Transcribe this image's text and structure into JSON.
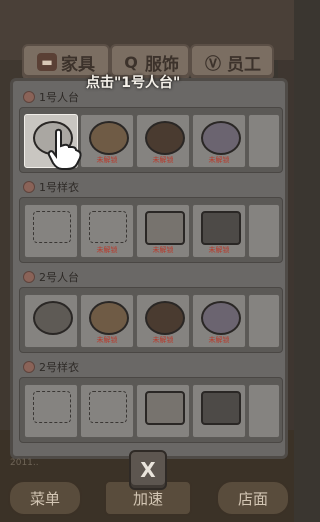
{
  "tabs": [
    {
      "label": "家具",
      "icon": "sofa-icon"
    },
    {
      "label": "服饰",
      "icon": "clothes-icon"
    },
    {
      "label": "员工",
      "icon": "staff-icon"
    }
  ],
  "hint": "点击\"1号人台\"",
  "sections": [
    {
      "title": "1号人台",
      "kind": "stand"
    },
    {
      "title": "1号样衣",
      "kind": "sample"
    },
    {
      "title": "2号人台",
      "kind": "stand"
    },
    {
      "title": "2号样衣",
      "kind": "sample"
    }
  ],
  "locked_label": "未解锁",
  "close_label": "X",
  "bottom": {
    "menu": "菜单",
    "speedup": "加速",
    "shop": "店面"
  },
  "money": "2011.."
}
